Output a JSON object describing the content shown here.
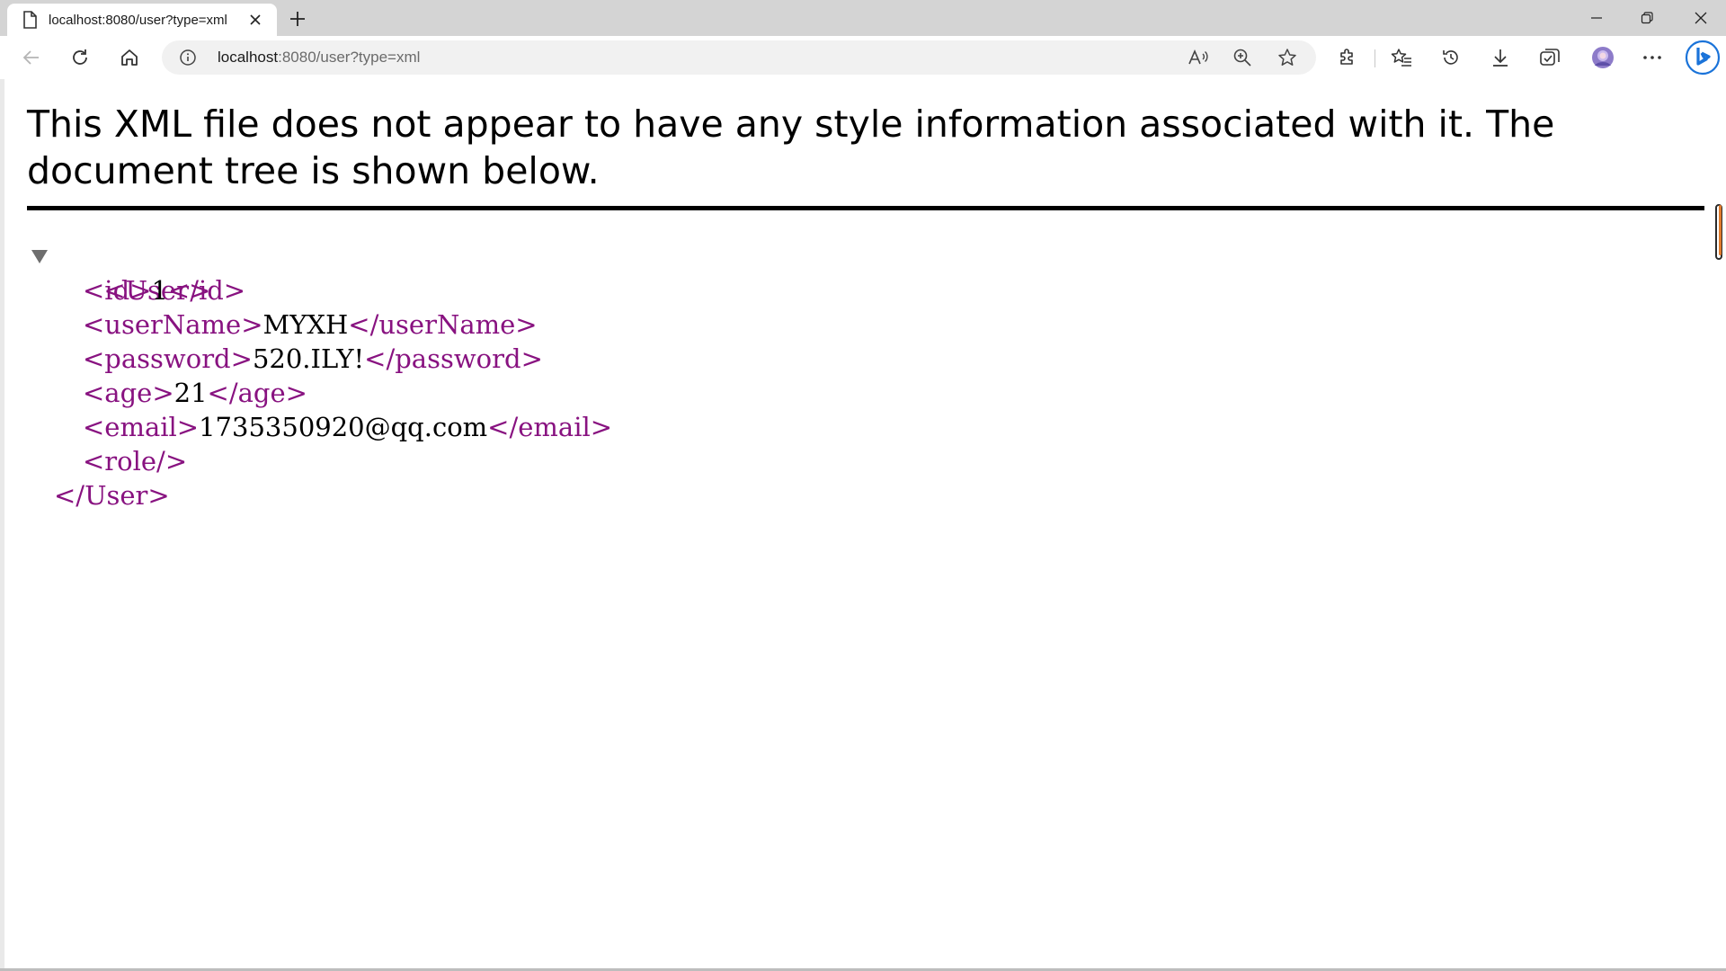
{
  "browser": {
    "tab": {
      "title": "localhost:8080/user?type=xml",
      "favicon": "page-icon"
    },
    "address": {
      "host": "localhost",
      "rest": ":8080/user?type=xml"
    },
    "toolbar_icons": [
      "back-icon",
      "refresh-icon",
      "home-icon",
      "info-icon",
      "read-aloud-icon",
      "zoom-icon",
      "favorite-star-icon",
      "extensions-icon",
      "favorites-icon",
      "history-icon",
      "downloads-icon",
      "collections-icon",
      "profile-avatar",
      "more-icon",
      "copilot-icon"
    ],
    "window_controls": [
      "minimize-icon",
      "restore-icon",
      "close-icon"
    ]
  },
  "page": {
    "notice": "This XML file does not appear to have any style information associated with it. The document tree is shown below.",
    "xml": {
      "root_open": "<User>",
      "root_close": "</User>",
      "fields": [
        {
          "open": "<id>",
          "value": "1",
          "close": "</id>"
        },
        {
          "open": "<userName>",
          "value": "MYXH",
          "close": "</userName>"
        },
        {
          "open": "<password>",
          "value": "520.ILY!",
          "close": "</password>"
        },
        {
          "open": "<age>",
          "value": "21",
          "close": "</age>"
        },
        {
          "open": "<email>",
          "value": "1735350920@qq.com",
          "close": "</email>"
        }
      ],
      "empty_element": "<role/>"
    }
  },
  "colors": {
    "tag": "#881280",
    "text": "#000000",
    "tabbar": "#d4d4d4",
    "address_bg": "#f1f1f1",
    "scroll_accent": "#e07b2d"
  }
}
